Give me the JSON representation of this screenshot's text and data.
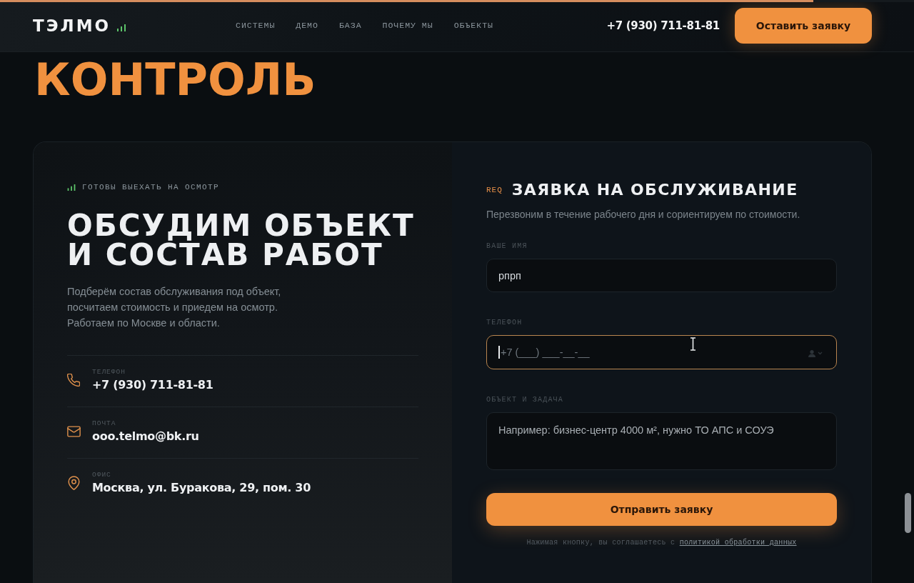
{
  "header": {
    "scroll_progress": {
      "level": 0.89
    },
    "logo": "ТЭЛМО",
    "nav": [
      {
        "label": "СИСТЕМЫ"
      },
      {
        "label": "ДЕМО"
      },
      {
        "label": "БАЗА"
      },
      {
        "label": "ПОЧЕМУ МЫ"
      },
      {
        "label": "ОБЪЕКТЫ"
      }
    ],
    "phone": "+7 (930) 711-81-81",
    "cta_button": "Оставить заявку"
  },
  "hero": {
    "title_line": "КОНТРОЛЬ"
  },
  "contact_panel": {
    "eyebrow": "ГОТОВЫ ВЫЕХАТЬ НА ОСМОТР",
    "title_lines": [
      "ОБСУДИМ ОБЪЕКТ",
      "И СОСТАВ РАБОТ"
    ],
    "text": "Подберём состав обслуживания под объект, посчитаем стоимость и приедем на осмотр. Работаем по Москве и области.",
    "contacts": [
      {
        "kind": "phone",
        "label": "ТЕЛЕФОН",
        "value": "+7 (930) 711-81-81"
      },
      {
        "kind": "email",
        "label": "ПОЧТА",
        "value": "ooo.telmo@bk.ru"
      },
      {
        "kind": "address",
        "label": "ОФИС",
        "value": "Москва, ул. Буракова, 29, пом. 30"
      }
    ]
  },
  "request_form": {
    "tag": "REQ",
    "title": "ЗАЯВКА НА ОБСЛУЖИВАНИЕ",
    "subtitle": "Перезвоним в течение рабочего дня и сориентируем по стоимости.",
    "fields": [
      {
        "kind": "text",
        "label": "ВАШЕ ИМЯ",
        "value": "рпрп",
        "focused": false
      },
      {
        "kind": "tel",
        "label": "ТЕЛЕФОН",
        "placeholder": "+7 (___) ___-__-__",
        "focused": true
      },
      {
        "kind": "textarea",
        "label": "ОБЪЕКТ И ЗАДАЧА",
        "placeholder": "Например: бизнес-центр 4000 м², нужно ТО АПС и СОУЭ",
        "focused": false
      }
    ],
    "submit_button": "Отправить заявку",
    "consent": {
      "text": "Нажимая кнопку, вы соглашаетесь с",
      "link": "политикой обработки данных"
    }
  }
}
